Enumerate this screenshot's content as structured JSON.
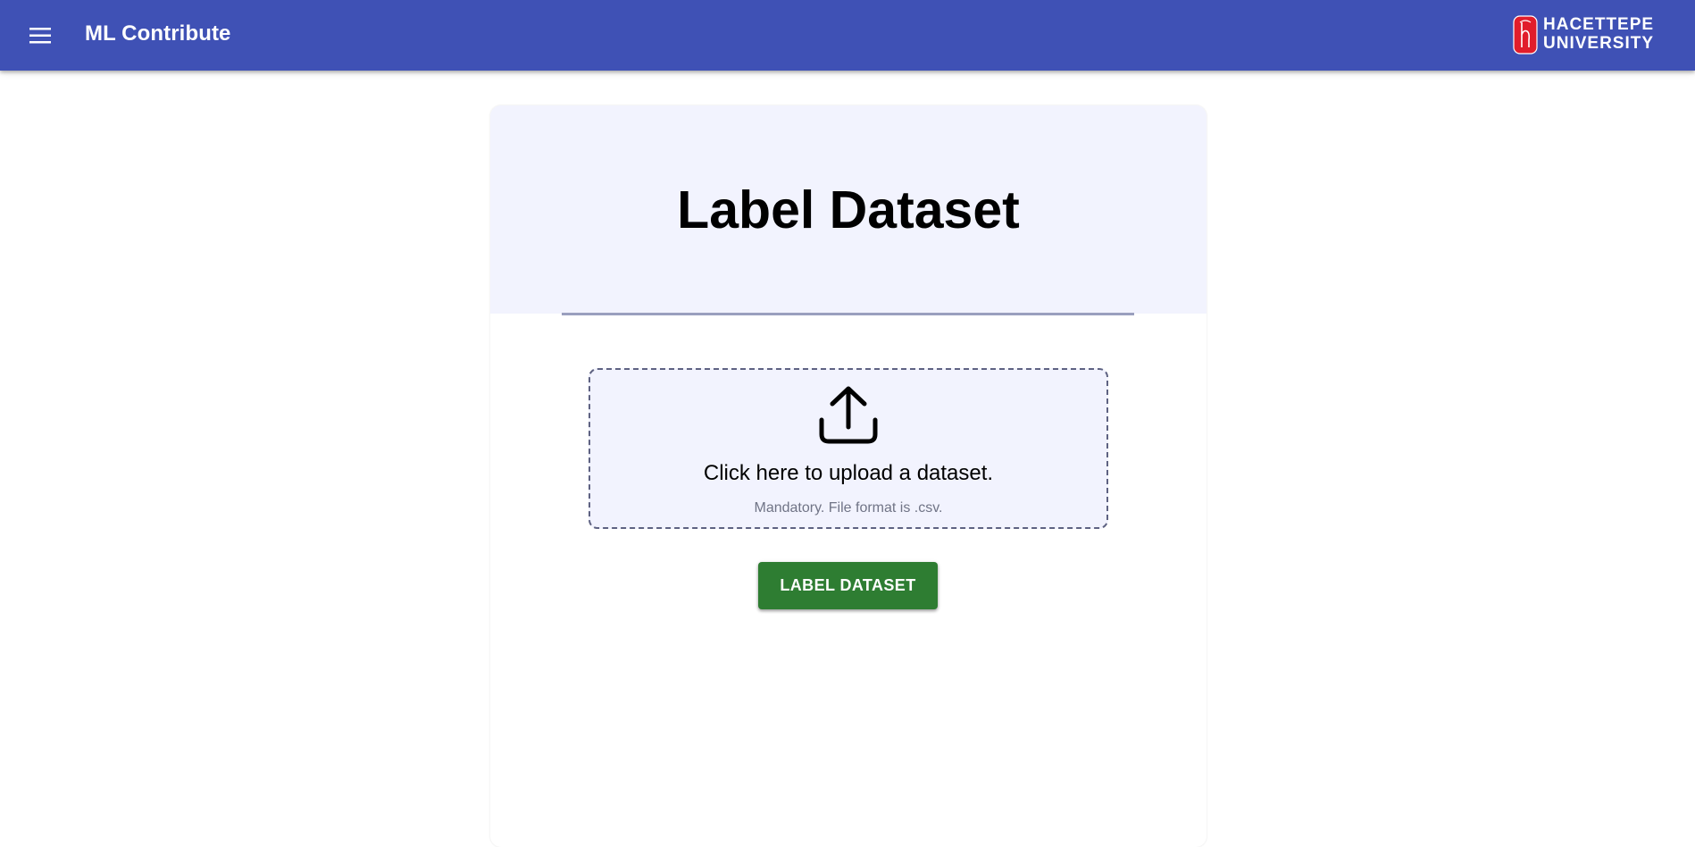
{
  "header": {
    "app_title": "ML Contribute",
    "menu_icon": "hamburger-menu-icon",
    "logo": {
      "line1": "HACETTEPE",
      "line2": "UNIVERSITY"
    },
    "background_color": "#3f51b5"
  },
  "main": {
    "title": "Label Dataset",
    "upload": {
      "icon": "upload-icon",
      "title": "Click here to upload a dataset.",
      "hint": "Mandatory. File format is .csv."
    },
    "submit_label": "LABEL DATASET",
    "submit_color": "#2e7d32"
  }
}
